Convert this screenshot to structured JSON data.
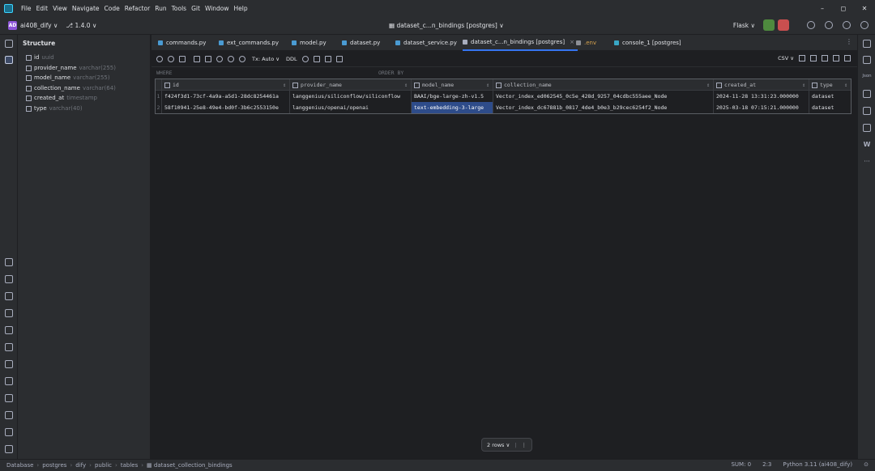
{
  "menu": [
    "File",
    "Edit",
    "View",
    "Navigate",
    "Code",
    "Refactor",
    "Run",
    "Tools",
    "Git",
    "Window",
    "Help"
  ],
  "window_controls": [
    "–",
    "◻",
    "✕"
  ],
  "project": {
    "badge": "AD",
    "name": "ai408_dify ∨",
    "branch": "⎇ 1.4.0 ∨"
  },
  "center_title": "▦ dataset_c...n_bindings [postgres] ∨",
  "run_config": "Flask ∨",
  "structure": {
    "title": "Structure",
    "fields": [
      {
        "name": "id",
        "type": "uuid"
      },
      {
        "name": "provider_name",
        "type": "varchar(255)"
      },
      {
        "name": "model_name",
        "type": "varchar(255)"
      },
      {
        "name": "collection_name",
        "type": "varchar(64)"
      },
      {
        "name": "created_at",
        "type": "timestamp"
      },
      {
        "name": "type",
        "type": "varchar(40)"
      }
    ]
  },
  "tabs": [
    {
      "label": "commands.py"
    },
    {
      "label": "ext_commands.py"
    },
    {
      "label": "model.py"
    },
    {
      "label": "dataset.py"
    },
    {
      "label": "dataset_service.py"
    },
    {
      "label": "dataset_c...n_bindings [postgres]"
    },
    {
      "label": ".env"
    },
    {
      "label": "console_1 [postgres]"
    }
  ],
  "dbtoolbar": {
    "tx": "Tx: Auto ∨",
    "ddl": "DDL",
    "csv": "CSV ∨"
  },
  "filters": {
    "where": "WHERE",
    "order": "ORDER BY"
  },
  "table": {
    "columns": [
      "id",
      "provider_name",
      "model_name",
      "collection_name",
      "created_at",
      "type"
    ],
    "rows": [
      {
        "num": "1",
        "cells": [
          "f424f3d1-73cf-4a9a-a5d1-28dc8254461a",
          "langgenius/siliconflow/siliconflow",
          "BAAI/bge-large-zh-v1.5",
          "Vector_index_ed062545_0c5e_428d_9257_04cdbc555aee_Node",
          "2024-11-28 13:31:23.000000",
          "dataset"
        ]
      },
      {
        "num": "2",
        "cells": [
          "58f10941-25e8-49e4-bd0f-3b6c2553150e",
          "langgenius/openai/openai",
          "text-embedding-3-large",
          "Vector_index_dc67881b_0817_4de4_b0e3_b29cec6254f2_Node",
          "2025-03-18 07:15:21.000000",
          "dataset"
        ]
      }
    ]
  },
  "rows_badge": "2 rows ∨",
  "rightbar_text": {
    "json": "Json",
    "w": "W",
    "more": "···"
  },
  "breadcrumb": [
    "Database",
    "postgres",
    "dify",
    "public",
    "tables",
    "▦ dataset_collection_bindings"
  ],
  "status": {
    "sum": "SUM: 0",
    "pos": "2:3",
    "interpreter": "Python 3.11 (ai408_dify)"
  }
}
